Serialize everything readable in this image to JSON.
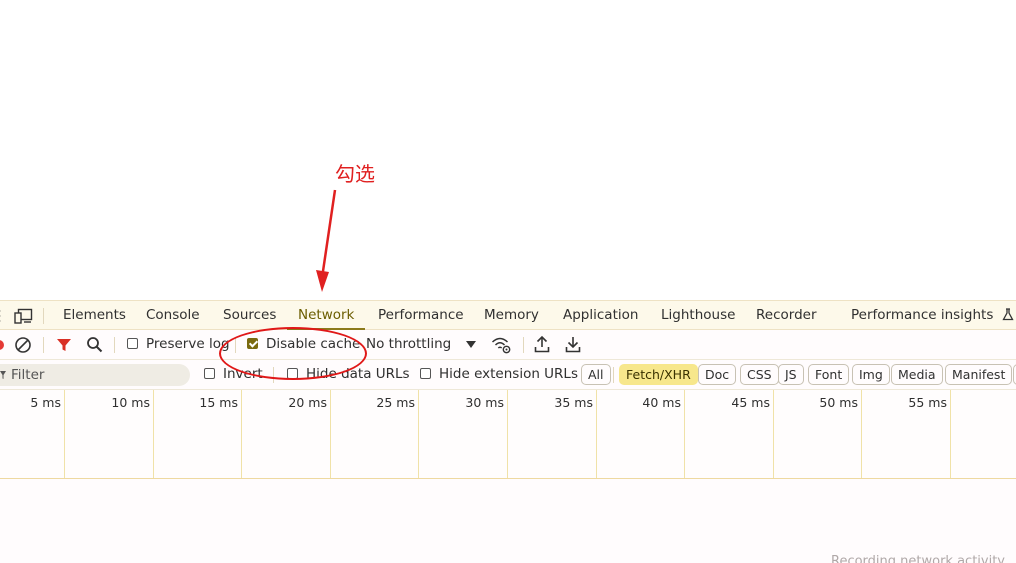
{
  "annotation": {
    "text": "勾选"
  },
  "tabs": [
    {
      "label": "Elements"
    },
    {
      "label": "Console"
    },
    {
      "label": "Sources"
    },
    {
      "label": "Network"
    },
    {
      "label": "Performance"
    },
    {
      "label": "Memory"
    },
    {
      "label": "Application"
    },
    {
      "label": "Lighthouse"
    },
    {
      "label": "Recorder"
    },
    {
      "label": "Performance insights"
    }
  ],
  "toolbar": {
    "preserve_log_label": "Preserve log",
    "preserve_log_checked": false,
    "disable_cache_label": "Disable cache",
    "disable_cache_checked": true,
    "throttling_value": "No throttling"
  },
  "filters": {
    "placeholder": "Filter",
    "invert_label": "Invert",
    "hide_data_urls_label": "Hide data URLs",
    "hide_extension_urls_label": "Hide extension URLs",
    "types": [
      {
        "label": "All",
        "active": false
      },
      {
        "label": "Fetch/XHR",
        "active": true
      },
      {
        "label": "Doc",
        "active": false
      },
      {
        "label": "CSS",
        "active": false
      },
      {
        "label": "JS",
        "active": false
      },
      {
        "label": "Font",
        "active": false
      },
      {
        "label": "Img",
        "active": false
      },
      {
        "label": "Media",
        "active": false
      },
      {
        "label": "Manifest",
        "active": false
      }
    ]
  },
  "timeline": {
    "ticks": [
      "5 ms",
      "10 ms",
      "15 ms",
      "20 ms",
      "25 ms",
      "30 ms",
      "35 ms",
      "40 ms",
      "45 ms",
      "50 ms",
      "55 ms",
      "60"
    ]
  },
  "status": {
    "recording_text": "Recording network activity…"
  },
  "colors": {
    "accent": "#8b7a1b",
    "annotation_red": "#e02020",
    "active_chip": "#f7e78c",
    "record_red": "#e53935",
    "filter_red": "#d93025"
  },
  "icons": {
    "kebab": "more-vert-icon",
    "device": "device-toolbar-icon",
    "record": "record-stop-icon",
    "clear": "clear-icon",
    "filter": "filter-icon",
    "search": "search-icon",
    "dropdown": "chevron-down-icon",
    "network_conditions": "wifi-settings-icon",
    "import": "upload-icon",
    "export": "download-icon",
    "experiment": "flask-icon"
  }
}
